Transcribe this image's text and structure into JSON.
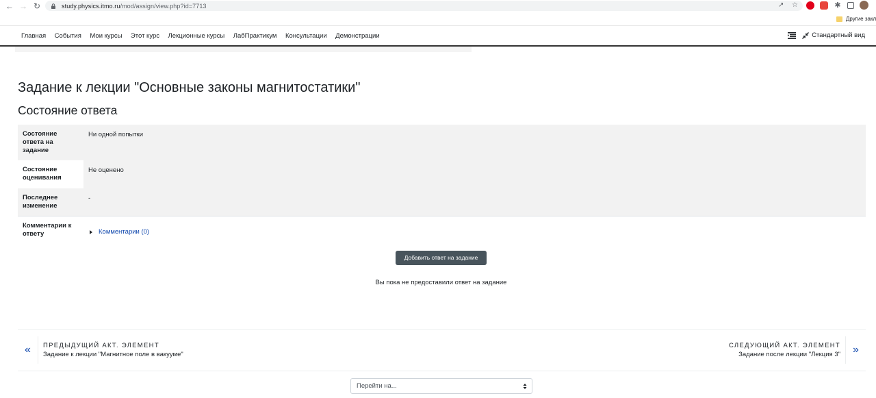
{
  "browser": {
    "url_host": "study.physics.itmo.ru",
    "url_path": "/mod/assign/view.php?id=7713",
    "bookmark_other": "Другие закла"
  },
  "navbar": {
    "links": [
      "Главная",
      "События",
      "Мои курсы",
      "Этот курс",
      "Лекционные курсы",
      "ЛабПрактикум",
      "Консультации",
      "Демонстрации"
    ],
    "standard_view": "Стандартный вид"
  },
  "page": {
    "title": "Задание к лекции \"Основные законы магнитостатики\"",
    "section_title": "Состояние ответа"
  },
  "status_table": [
    {
      "label": "Состояние ответа на задание",
      "value": "Ни одной попытки"
    },
    {
      "label": "Состояние оценивания",
      "value": "Не оценено"
    },
    {
      "label": "Последнее изменение",
      "value": "-"
    },
    {
      "label": "Комментарии к ответу",
      "value": "Комментарии (0)"
    }
  ],
  "actions": {
    "add_submission": "Добавить ответ на задание",
    "no_submission_text": "Вы пока не предоставили ответ на задание"
  },
  "activity_nav": {
    "prev_kicker": "ПРЕДЫДУЩИЙ АКТ. ЭЛЕМЕНТ",
    "prev_target": "Задание к лекции \"Магнитное поле в вакууме\"",
    "next_kicker": "СЛЕДУЮЩИЙ АКТ. ЭЛЕМЕНТ",
    "next_target": "Задание после лекции \"Лекция 3\"",
    "jump_placeholder": "Перейти на..."
  },
  "colors": {
    "link": "#0f47ad",
    "button": "#48545c",
    "table_gray": "#f2f2f2"
  }
}
